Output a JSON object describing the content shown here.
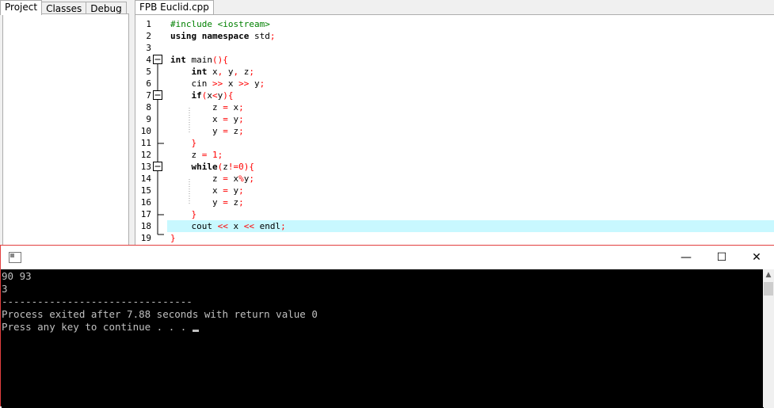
{
  "panel_tabs": [
    "Project",
    "Classes",
    "Debug"
  ],
  "editor_tab": "FPB Euclid.cpp",
  "code_lines": [
    {
      "n": "1",
      "html": "<span class=\"pp\">#include &lt;iostream&gt;</span>"
    },
    {
      "n": "2",
      "html": "<span class=\"kw\">using namespace</span> std<span class=\"sym\">;</span>"
    },
    {
      "n": "3",
      "html": ""
    },
    {
      "n": "4",
      "html": "<span class=\"kw\">int</span> main<span class=\"sym\">(){</span>"
    },
    {
      "n": "5",
      "html": "    <span class=\"kw\">int</span> x<span class=\"sym\">,</span> y<span class=\"sym\">,</span> z<span class=\"sym\">;</span>"
    },
    {
      "n": "6",
      "html": "    cin <span class=\"sym\">&gt;&gt;</span> x <span class=\"sym\">&gt;&gt;</span> y<span class=\"sym\">;</span>"
    },
    {
      "n": "7",
      "html": "    <span class=\"kw\">if</span><span class=\"sym\">(</span>x<span class=\"sym\">&lt;</span>y<span class=\"sym\">){</span>"
    },
    {
      "n": "8",
      "html": "        z <span class=\"sym\">=</span> x<span class=\"sym\">;</span>"
    },
    {
      "n": "9",
      "html": "        x <span class=\"sym\">=</span> y<span class=\"sym\">;</span>"
    },
    {
      "n": "10",
      "html": "        y <span class=\"sym\">=</span> z<span class=\"sym\">;</span>"
    },
    {
      "n": "11",
      "html": "    <span class=\"sym\">}</span>"
    },
    {
      "n": "12",
      "html": "    z <span class=\"sym\">=</span> <span class=\"sym\">1;</span>"
    },
    {
      "n": "13",
      "html": "    <span class=\"kw\">while</span><span class=\"sym\">(</span>z<span class=\"sym\">!=0){</span>"
    },
    {
      "n": "14",
      "html": "        z <span class=\"sym\">=</span> x<span class=\"sym\">%</span>y<span class=\"sym\">;</span>"
    },
    {
      "n": "15",
      "html": "        x <span class=\"sym\">=</span> y<span class=\"sym\">;</span>"
    },
    {
      "n": "16",
      "html": "        y <span class=\"sym\">=</span> z<span class=\"sym\">;</span>"
    },
    {
      "n": "17",
      "html": "    <span class=\"sym\">}</span>"
    },
    {
      "n": "18",
      "html": "    cout <span class=\"sym\">&lt;&lt;</span> x <span class=\"sym\">&lt;&lt;</span> endl<span class=\"sym\">;</span>"
    },
    {
      "n": "19",
      "html": "<span class=\"sym\">}</span>"
    }
  ],
  "highlighted_line": "18",
  "console": {
    "minimize_glyph": "—",
    "maximize_glyph": "☐",
    "close_glyph": "✕",
    "lines": [
      "90 93",
      "3",
      "",
      "--------------------------------",
      "Process exited after 7.88 seconds with return value 0",
      "Press any key to continue . . . "
    ]
  },
  "colors": {
    "highlight": "#c8f8ff",
    "keyword_symbol": "#ff0000",
    "preprocessor": "#008000",
    "console_text": "#c0c0c0",
    "console_bg": "#000000"
  }
}
